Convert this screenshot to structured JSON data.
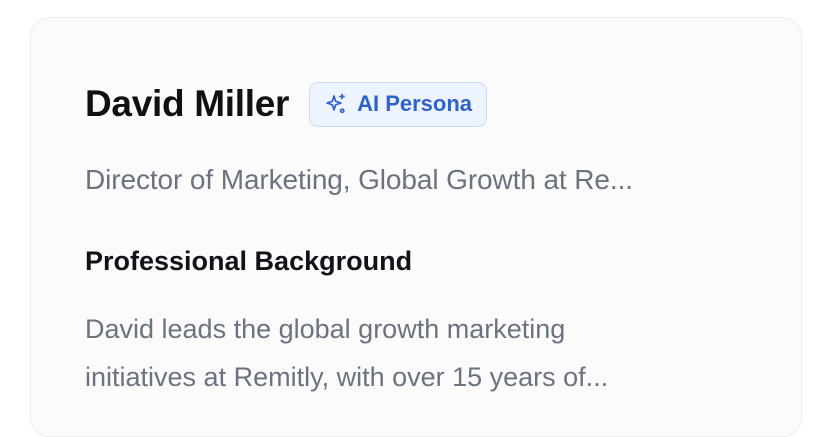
{
  "profile": {
    "name": "David Miller",
    "badge_label": "AI Persona",
    "badge_icon": "sparkles-icon",
    "title": "Director of Marketing, Global Growth at Re..."
  },
  "background_section": {
    "heading": "Professional Background",
    "lines": [
      "David leads the global growth marketing",
      "initiatives at Remitly, with over 15 years of..."
    ]
  },
  "colors": {
    "badge_text": "#2f63c9",
    "badge_bg": "#eef4ff",
    "badge_border": "#c9dbf6",
    "muted_text": "#6b7280",
    "heading_text": "#0f1115"
  }
}
